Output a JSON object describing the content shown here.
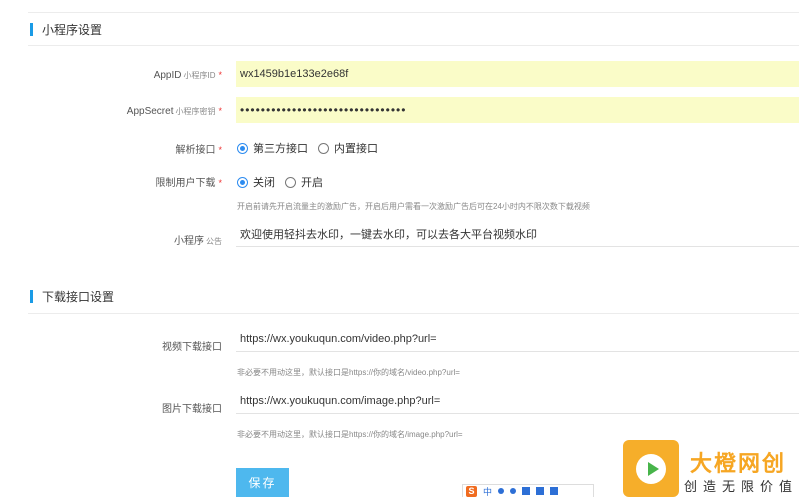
{
  "miniapp_section": {
    "title": "小程序设置",
    "appid": {
      "label": "AppID",
      "label_small": "小程序ID",
      "required_mark": "*",
      "value": "wx1459b1e133e2e68f"
    },
    "appsecret": {
      "label": "AppSecret",
      "label_small": "小程序密钥",
      "required_mark": "*",
      "value": "••••••••••••••••••••••••••••••••"
    },
    "parse_api": {
      "label": "解析接口",
      "required_mark": "*",
      "options": [
        "第三方接口",
        "内置接口"
      ],
      "selected": "第三方接口"
    },
    "limit_download": {
      "label": "限制用户下载",
      "required_mark": "*",
      "options": [
        "关闭",
        "开启"
      ],
      "selected": "关闭"
    },
    "limit_hint": "开启前请先开启流量主的激励广告，开启后用户需看一次激励广告后可在24小时内不限次数下载视频",
    "notice": {
      "label": "小程序",
      "label_small": "公告",
      "value": "欢迎使用轻抖去水印，一键去水印，可以去各大平台视频水印"
    }
  },
  "download_section": {
    "title": "下载接口设置",
    "video": {
      "label": "视频下载接口",
      "value": "https://wx.youkuqun.com/video.php?url=",
      "hint": "非必要不用动这里，默认接口是https://你的域名/video.php?url="
    },
    "image": {
      "label": "图片下载接口",
      "value": "https://wx.youkuqun.com/image.php?url=",
      "hint": "非必要不用动这里，默认接口是https://你的域名/image.php?url="
    }
  },
  "save_label": "保存",
  "ime": {
    "logo": "S",
    "lang": "中"
  },
  "watermark": {
    "title": "大橙网创",
    "subtitle": "创造无限价值"
  },
  "colors": {
    "accent": "#1a9be6",
    "button": "#4eb8ee",
    "autofill": "#fafcc8",
    "required": "#e33333",
    "watermark": "#f6a623"
  }
}
